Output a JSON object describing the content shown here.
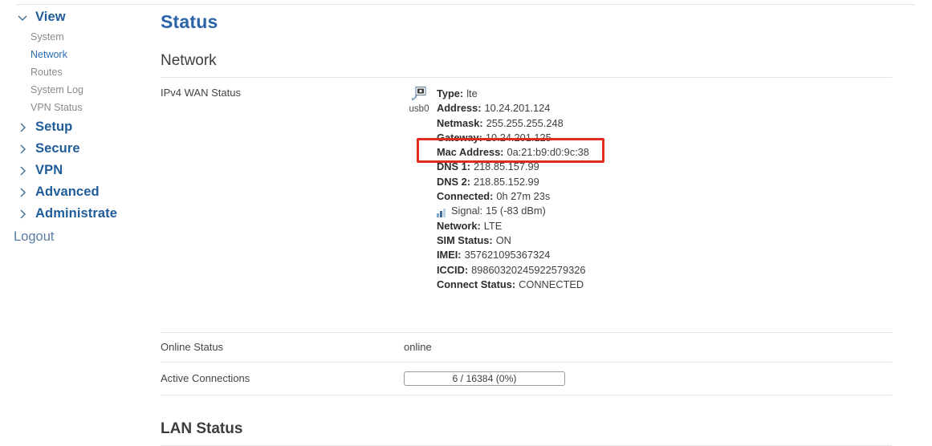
{
  "sidebar": {
    "groups": [
      {
        "label": "View",
        "expanded": true,
        "icon": "chevron-down-icon"
      },
      {
        "label": "Setup",
        "expanded": false,
        "icon": "chevron-right-icon"
      },
      {
        "label": "Secure",
        "expanded": false,
        "icon": "chevron-right-icon"
      },
      {
        "label": "VPN",
        "expanded": false,
        "icon": "chevron-right-icon"
      },
      {
        "label": "Advanced",
        "expanded": false,
        "icon": "chevron-right-icon"
      },
      {
        "label": "Administrate",
        "expanded": false,
        "icon": "chevron-right-icon"
      }
    ],
    "view_items": [
      {
        "label": "System",
        "active": false
      },
      {
        "label": "Network",
        "active": true
      },
      {
        "label": "Routes",
        "active": false
      },
      {
        "label": "System Log",
        "active": false
      },
      {
        "label": "VPN Status",
        "active": false
      }
    ],
    "logout_label": "Logout",
    "active_color": "#2a6db5",
    "group_color": "#1f5c99"
  },
  "main": {
    "page_title": "Status",
    "network_section_title": "Network",
    "lan_section_title": "LAN Status",
    "wan_row_label": "IPv4 WAN Status",
    "online_row_label": "Online Status",
    "online_value": "online",
    "active_connections_label": "Active Connections",
    "active_connections_value": "6 / 16384 (0%)",
    "interface": {
      "name": "usb0",
      "icon": "network-interface-icon"
    },
    "wan": [
      {
        "key": "Type:",
        "value": "lte",
        "icon": null
      },
      {
        "key": "Address:",
        "value": "10.24.201.124",
        "icon": null
      },
      {
        "key": "Netmask:",
        "value": "255.255.255.248",
        "icon": null
      },
      {
        "key": "Gateway:",
        "value": "10.24.201.125",
        "icon": null
      },
      {
        "key": "Mac Address:",
        "value": "0a:21:b9:d0:9c:38",
        "icon": null
      },
      {
        "key": "DNS 1:",
        "value": "218.85.157.99",
        "icon": null
      },
      {
        "key": "DNS 2:",
        "value": "218.85.152.99",
        "icon": null
      },
      {
        "key": "Connected:",
        "value": "0h 27m 23s",
        "icon": null
      },
      {
        "key": "Signal:",
        "value": "15 (-83 dBm)",
        "icon": "signal-bars-icon"
      },
      {
        "key": "Network:",
        "value": "LTE",
        "icon": null
      },
      {
        "key": "SIM Status:",
        "value": "ON",
        "icon": null
      },
      {
        "key": "IMEI:",
        "value": "357621095367324",
        "icon": null
      },
      {
        "key": "ICCID:",
        "value": "89860320245922579326",
        "icon": null
      },
      {
        "key": "Connect Status:",
        "value": "CONNECTED",
        "icon": null
      }
    ]
  },
  "annotation": {
    "highlight_color": "#e02b20",
    "target": "Mac Address: 0a:21:b9:d0:9c:38"
  }
}
